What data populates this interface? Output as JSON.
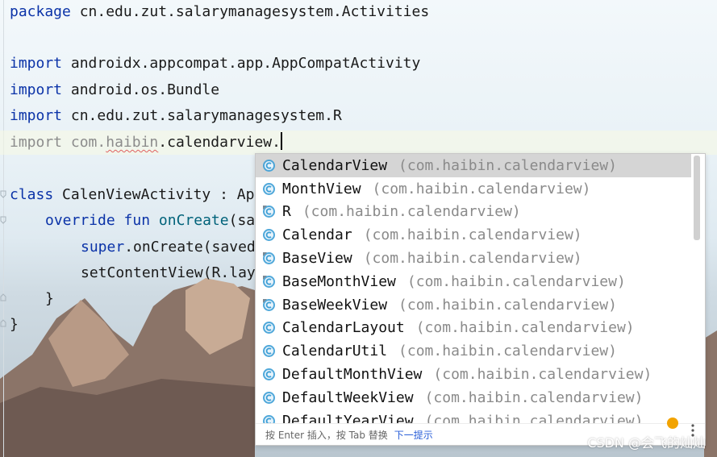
{
  "editor": {
    "line_package": {
      "keyword": "package",
      "text": "cn.edu.zut.salarymanagesystem.Activities"
    },
    "import1": {
      "keyword": "import",
      "text": "androidx.appcompat.app.AppCompatActivity"
    },
    "import2": {
      "keyword": "import",
      "text": "android.os.Bundle"
    },
    "import3": {
      "keyword": "import",
      "text": "cn.edu.zut.salarymanagesystem.R"
    },
    "import4": {
      "keyword": "import",
      "prefix": "com.",
      "error_word": "haibin",
      "suffix": ".calendarview."
    },
    "class_line": {
      "keyword": "class",
      "name": "CalenViewActivity",
      "rest": " : Ap"
    },
    "override_line": {
      "kw1": "override",
      "kw2": "fun",
      "fn": "onCreate",
      "rest": "(sa"
    },
    "super_line": {
      "kw": "super",
      "rest": ".onCreate(saved"
    },
    "setcontent_line": {
      "fn": "setContentView",
      "rest": "(R.lay"
    },
    "close_inner": "}",
    "close_outer": "}"
  },
  "popup": {
    "items": [
      {
        "name": "CalendarView",
        "pkg": "(com.haibin.calendarview)",
        "icon": "class-icon",
        "selected": true
      },
      {
        "name": "MonthView",
        "pkg": "(com.haibin.calendarview)",
        "icon": "class-icon"
      },
      {
        "name": "R",
        "pkg": "(com.haibin.calendarview)",
        "icon": "class-icon"
      },
      {
        "name": "Calendar",
        "pkg": "(com.haibin.calendarview)",
        "icon": "class-icon"
      },
      {
        "name": "BaseView",
        "pkg": "(com.haibin.calendarview)",
        "icon": "abstract-class-icon"
      },
      {
        "name": "BaseMonthView",
        "pkg": "(com.haibin.calendarview)",
        "icon": "abstract-class-icon"
      },
      {
        "name": "BaseWeekView",
        "pkg": "(com.haibin.calendarview)",
        "icon": "abstract-class-icon"
      },
      {
        "name": "CalendarLayout",
        "pkg": "(com.haibin.calendarview)",
        "icon": "class-icon"
      },
      {
        "name": "CalendarUtil",
        "pkg": "(com.haibin.calendarview)",
        "icon": "class-icon"
      },
      {
        "name": "DefaultMonthView",
        "pkg": "(com.haibin.calendarview)",
        "icon": "class-icon"
      },
      {
        "name": "DefaultWeekView",
        "pkg": "(com.haibin.calendarview)",
        "icon": "class-icon"
      },
      {
        "name": "DefaultYearView",
        "pkg": "(com.haibin.calendarview)",
        "icon": "class-icon"
      }
    ],
    "footer_hint": "按 Enter 插入，按 Tab 替换",
    "footer_link": "下一提示"
  },
  "watermark": "CSDN @会飞的灿灿",
  "colors": {
    "keyword": "#0b33a8",
    "function": "#00627a",
    "selection": "#d5d5d5",
    "link": "#2a5fd8",
    "class_icon": "#3d9fd6"
  }
}
